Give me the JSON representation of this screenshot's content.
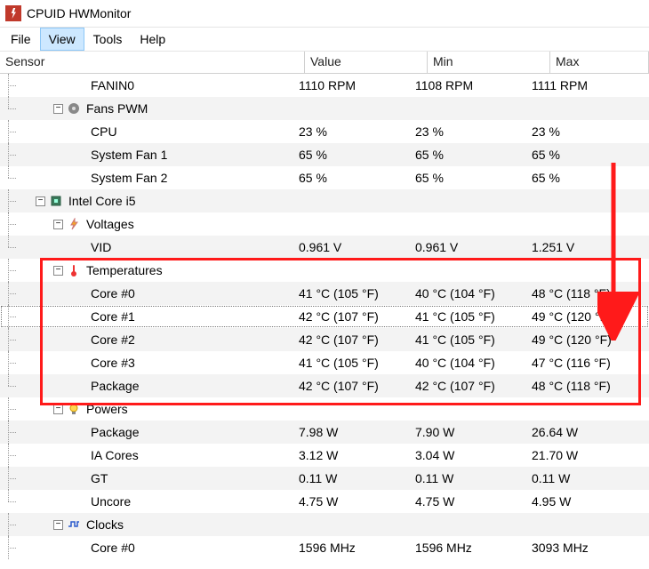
{
  "app": {
    "title": "CPUID HWMonitor"
  },
  "menu": {
    "file": "File",
    "view": "View",
    "tools": "Tools",
    "help": "Help"
  },
  "headers": {
    "sensor": "Sensor",
    "value": "Value",
    "min": "Min",
    "max": "Max"
  },
  "rows": {
    "fanin0": {
      "name": "FANIN0",
      "value": "1110 RPM",
      "min": "1108 RPM",
      "max": "1111 RPM"
    },
    "fanspwm": {
      "name": "Fans PWM"
    },
    "cpu_pwm": {
      "name": "CPU",
      "value": "23 %",
      "min": "23 %",
      "max": "23 %"
    },
    "sysfan1": {
      "name": "System Fan 1",
      "value": "65 %",
      "min": "65 %",
      "max": "65 %"
    },
    "sysfan2": {
      "name": "System Fan 2",
      "value": "65 %",
      "min": "65 %",
      "max": "65 %"
    },
    "cpu_node": {
      "name": "Intel Core i5"
    },
    "voltages": {
      "name": "Voltages"
    },
    "vid": {
      "name": "VID",
      "value": "0.961 V",
      "min": "0.961 V",
      "max": "1.251 V"
    },
    "temps": {
      "name": "Temperatures"
    },
    "core0": {
      "name": "Core #0",
      "value": "41 °C  (105 °F)",
      "min": "40 °C  (104 °F)",
      "max": "48 °C  (118 °F)"
    },
    "core1": {
      "name": "Core #1",
      "value": "42 °C  (107 °F)",
      "min": "41 °C  (105 °F)",
      "max": "49 °C  (120 °F)"
    },
    "core2": {
      "name": "Core #2",
      "value": "42 °C  (107 °F)",
      "min": "41 °C  (105 °F)",
      "max": "49 °C  (120 °F)"
    },
    "core3": {
      "name": "Core #3",
      "value": "41 °C  (105 °F)",
      "min": "40 °C  (104 °F)",
      "max": "47 °C  (116 °F)"
    },
    "pkg_temp": {
      "name": "Package",
      "value": "42 °C  (107 °F)",
      "min": "42 °C  (107 °F)",
      "max": "48 °C  (118 °F)"
    },
    "powers": {
      "name": "Powers"
    },
    "pkg_pw": {
      "name": "Package",
      "value": "7.98 W",
      "min": "7.90 W",
      "max": "26.64 W"
    },
    "iacores": {
      "name": "IA Cores",
      "value": "3.12 W",
      "min": "3.04 W",
      "max": "21.70 W"
    },
    "gt": {
      "name": "GT",
      "value": "0.11 W",
      "min": "0.11 W",
      "max": "0.11 W"
    },
    "uncore": {
      "name": "Uncore",
      "value": "4.75 W",
      "min": "4.75 W",
      "max": "4.95 W"
    },
    "clocks": {
      "name": "Clocks"
    },
    "clk_core0": {
      "name": "Core #0",
      "value": "1596 MHz",
      "min": "1596 MHz",
      "max": "3093 MHz"
    }
  }
}
